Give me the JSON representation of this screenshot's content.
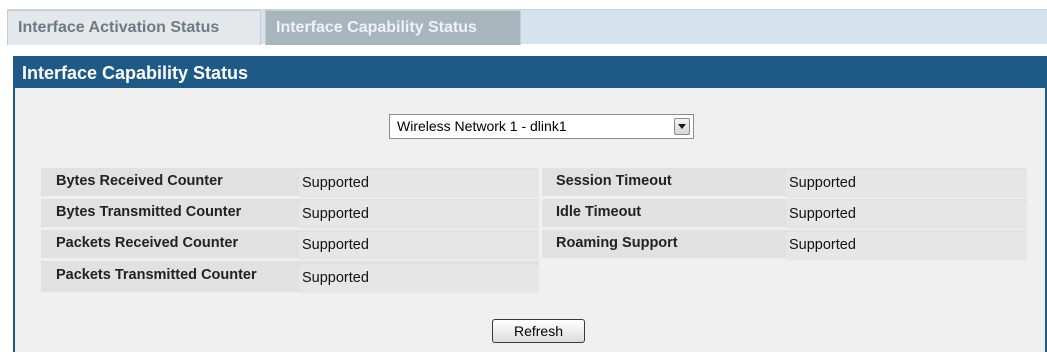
{
  "tabs": [
    {
      "label": "Interface Activation Status",
      "active": false
    },
    {
      "label": "Interface Capability Status",
      "active": true
    }
  ],
  "panel": {
    "title": "Interface Capability Status",
    "network_select": {
      "value": "Wireless Network 1 - dlink1"
    },
    "left_rows": [
      {
        "label": "Bytes Received Counter",
        "value": "Supported"
      },
      {
        "label": "Bytes Transmitted Counter",
        "value": "Supported"
      },
      {
        "label": "Packets Received Counter",
        "value": "Supported"
      },
      {
        "label": "Packets Transmitted Counter",
        "value": "Supported"
      }
    ],
    "right_rows": [
      {
        "label": "Session Timeout",
        "value": "Supported"
      },
      {
        "label": "Idle Timeout",
        "value": "Supported"
      },
      {
        "label": "Roaming Support",
        "value": "Supported"
      }
    ],
    "refresh_label": "Refresh"
  },
  "colors": {
    "header_blue": "#1f5a87",
    "panel_bg": "#f0f0f0",
    "tab_bar_bg": "#d4e3ee"
  }
}
